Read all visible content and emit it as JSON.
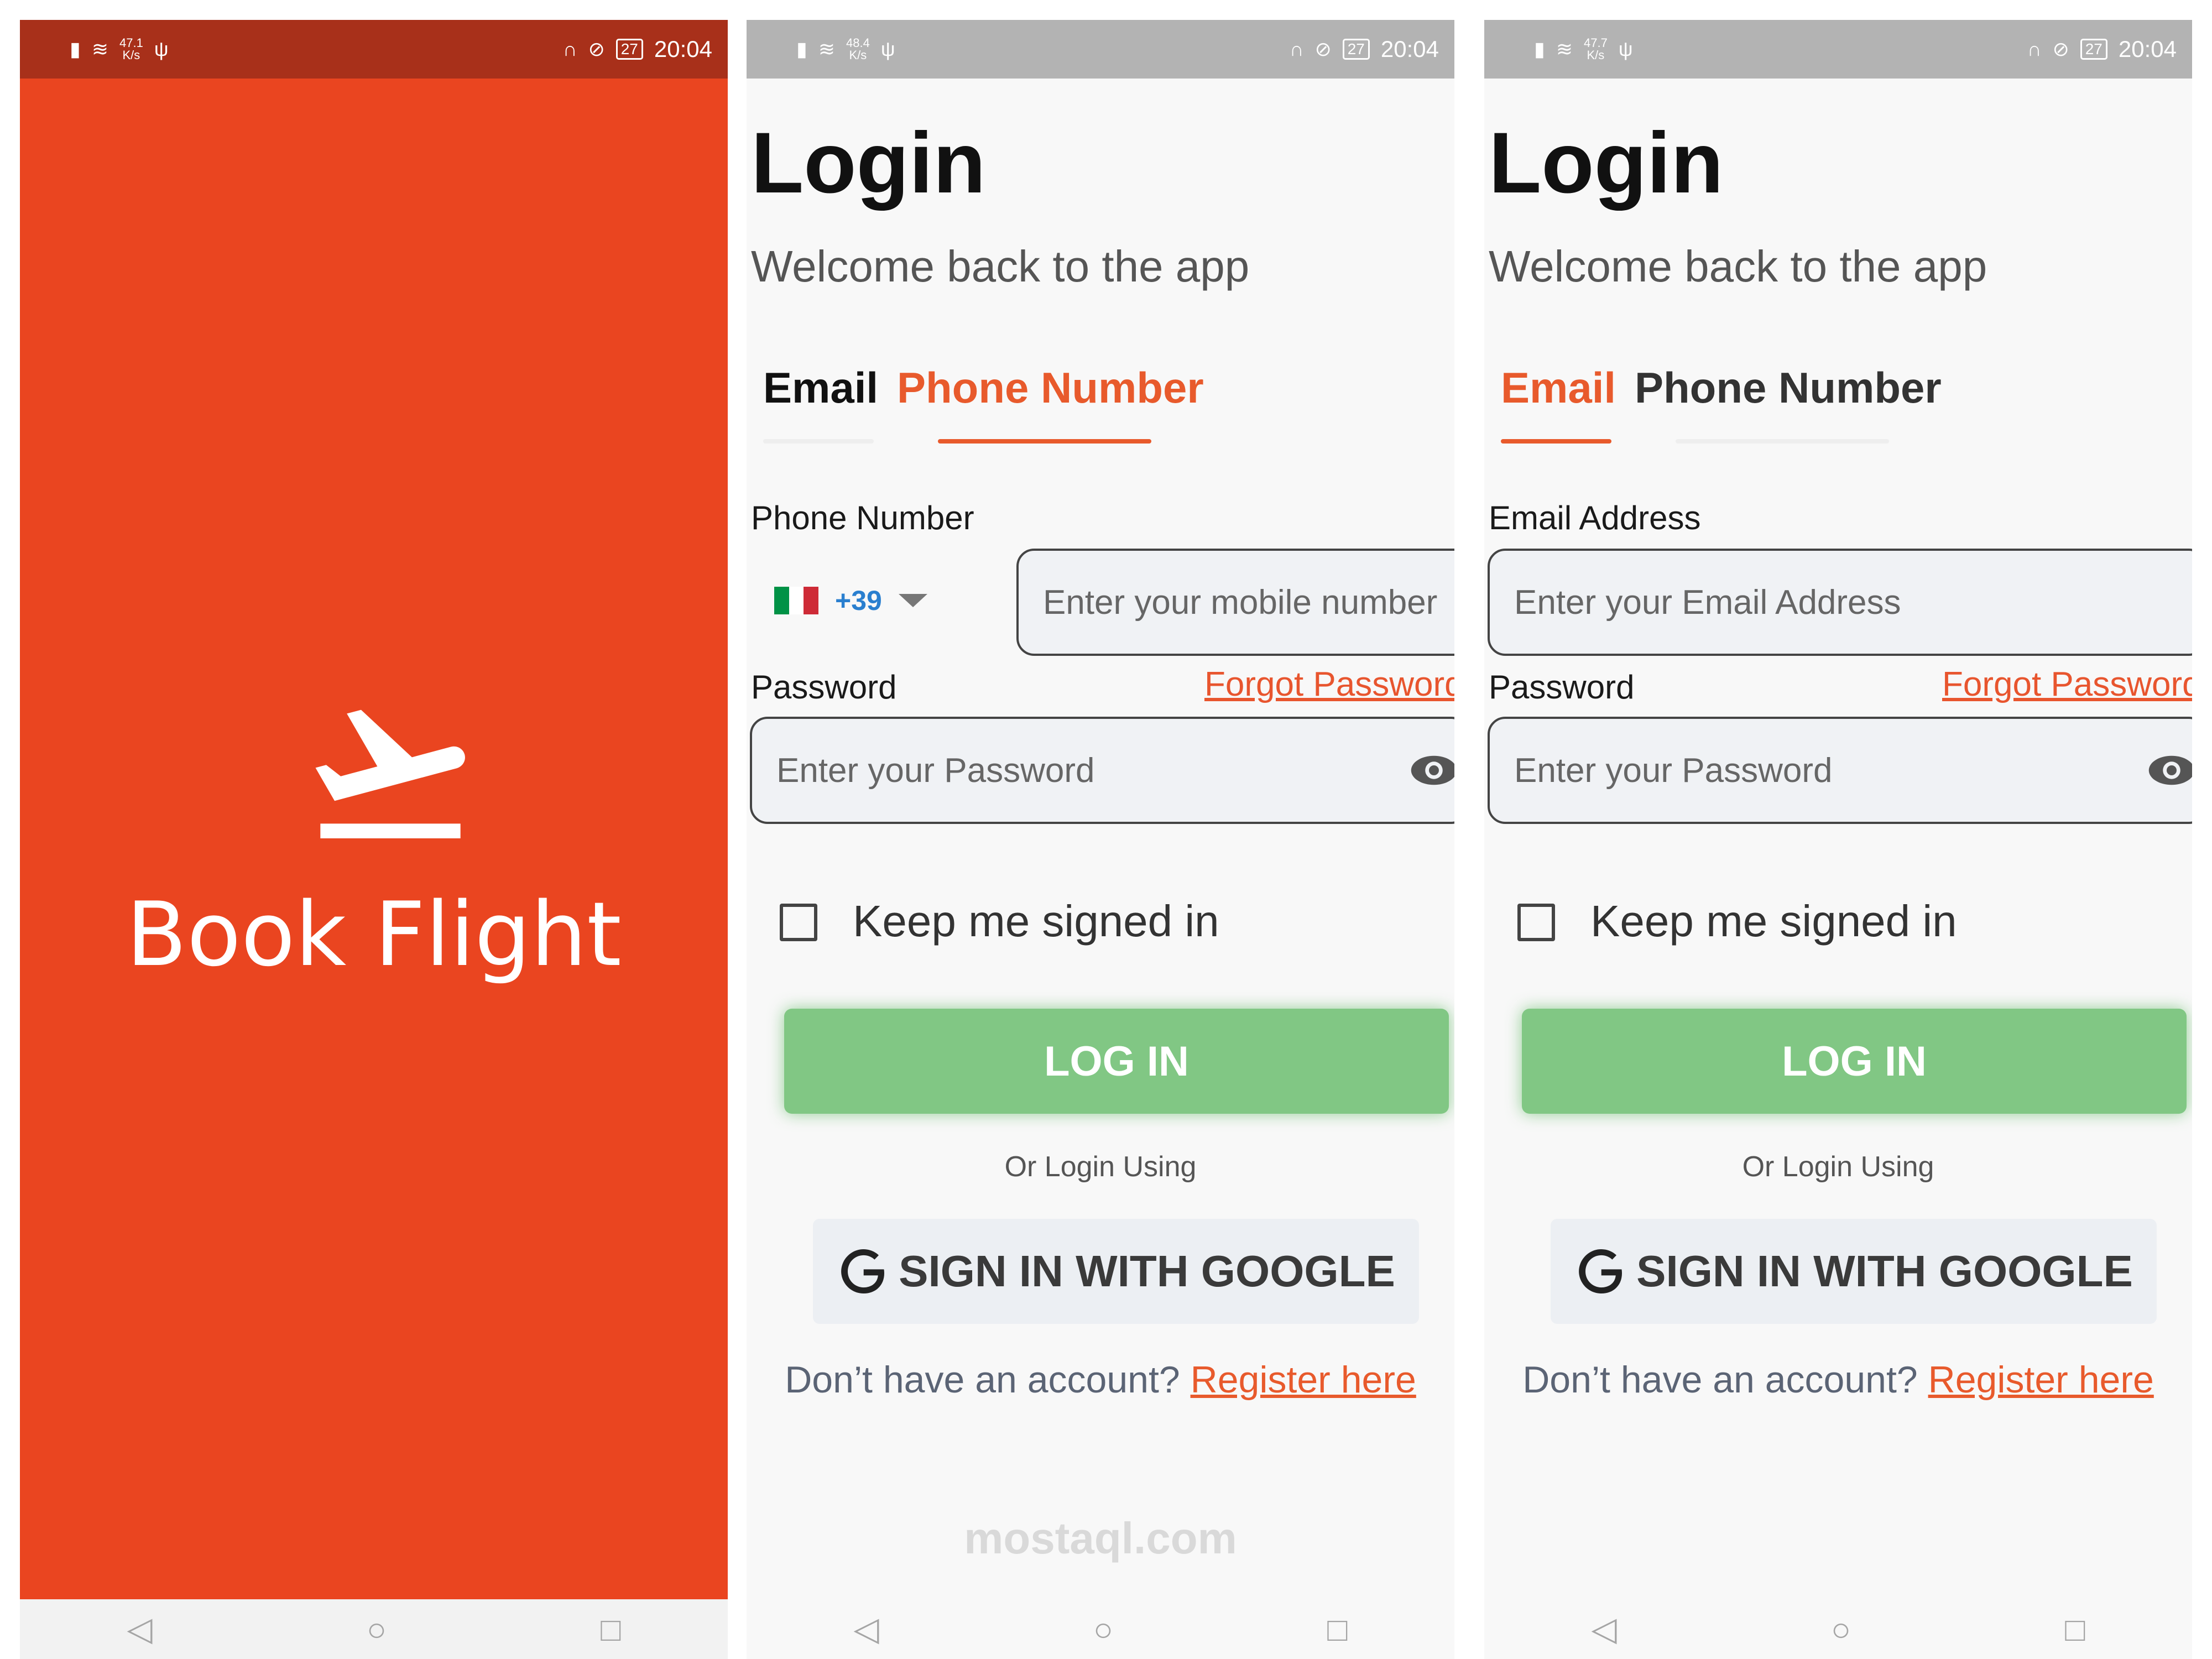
{
  "status_bars": [
    {
      "net_speed": "47.1",
      "net_unit": "K/s",
      "battery": "27",
      "time": "20:04"
    },
    {
      "net_speed": "48.4",
      "net_unit": "K/s",
      "battery": "27",
      "time": "20:04"
    },
    {
      "net_speed": "47.7",
      "net_unit": "K/s",
      "battery": "27",
      "time": "20:04"
    }
  ],
  "splash": {
    "title": "Book Flight",
    "background_color": "#ea4520",
    "icon": "flight-takeoff-icon"
  },
  "login_phone": {
    "title": "Login",
    "subtitle": "Welcome back to the app",
    "tabs": [
      {
        "label": "Email",
        "active": false
      },
      {
        "label": "Phone Number",
        "active": true
      }
    ],
    "phone_label": "Phone Number",
    "country_code": "+39",
    "country_flag": "italy-flag-icon",
    "phone_placeholder": "Enter your mobile number",
    "password_label": "Password",
    "forgot_password": "Forgot Password",
    "password_placeholder": "Enter your Password",
    "keep_signed_in": "Keep me signed in",
    "login_button": "LOG IN",
    "or_login_using": "Or Login Using",
    "google_button": "SIGN IN WITH GOOGLE",
    "no_account": "Don’t have an account? ",
    "register_link": "Register here"
  },
  "login_email": {
    "title": "Login",
    "subtitle": "Welcome back to the app",
    "tabs": [
      {
        "label": "Email",
        "active": true
      },
      {
        "label": "Phone Number",
        "active": false
      }
    ],
    "email_label": "Email Address",
    "email_placeholder": "Enter your Email Address",
    "password_label": "Password",
    "forgot_password": "Forgot Password",
    "password_placeholder": "Enter your Password",
    "keep_signed_in": "Keep me signed in",
    "login_button": "LOG IN",
    "or_login_using": "Or Login Using",
    "google_button": "SIGN IN WITH GOOGLE",
    "no_account": "Don’t have an account? ",
    "register_link": "Register here"
  },
  "watermark": "mostaql.com",
  "colors": {
    "accent": "#e85a2c",
    "login_button": "#81c784",
    "splash": "#ea4520"
  }
}
